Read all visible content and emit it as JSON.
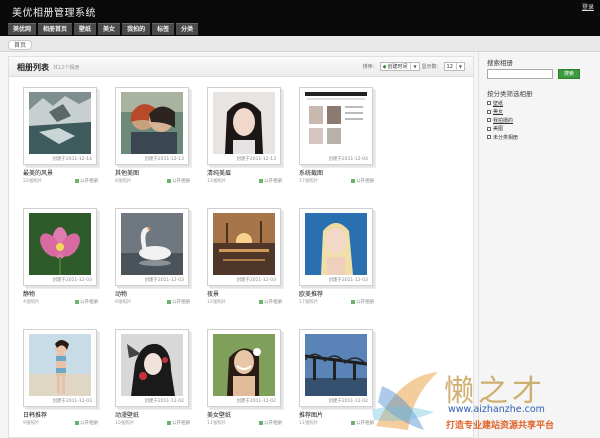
{
  "header": {
    "title": "美优相册管理系统",
    "login_label": "登录",
    "nav": [
      {
        "label": "美优网"
      },
      {
        "label": "相册首页"
      },
      {
        "label": "壁纸"
      },
      {
        "label": "美女"
      },
      {
        "label": "我拍的"
      },
      {
        "label": "标签"
      },
      {
        "label": "分类"
      }
    ]
  },
  "breadcrumb": {
    "home": "首页"
  },
  "main": {
    "title": "相册列表",
    "count_text": "共12个相册",
    "sort_label": "排序：",
    "sort_value": "创建时间",
    "show_label": "显示数：",
    "show_value": "12",
    "albums": [
      {
        "name": "最美的风景",
        "date": "创建于2011-12-14",
        "count": "22张照片",
        "status": "公开相册"
      },
      {
        "name": "其他美图",
        "date": "创建于2011-12-13",
        "count": "8张照片",
        "status": "公开相册"
      },
      {
        "name": "清纯美眉",
        "date": "创建于2011-12-13",
        "count": "13张照片",
        "status": "公开相册"
      },
      {
        "name": "系统截图",
        "date": "创建于2011-12-04",
        "count": "17张照片",
        "status": "公开相册"
      },
      {
        "name": "静物",
        "date": "创建于2011-12-03",
        "count": "4张照片",
        "status": "公开相册"
      },
      {
        "name": "动物",
        "date": "创建于2011-12-03",
        "count": "6张照片",
        "status": "公开相册"
      },
      {
        "name": "夜景",
        "date": "创建于2011-12-03",
        "count": "12张照片",
        "status": "公开相册"
      },
      {
        "name": "欧美推荐",
        "date": "创建于2011-12-03",
        "count": "17张照片",
        "status": "公开相册"
      },
      {
        "name": "日韩推荐",
        "date": "创建于2011-12-03",
        "count": "9张照片",
        "status": "公开相册"
      },
      {
        "name": "动漫壁纸",
        "date": "创建于2011-12-02",
        "count": "10张照片",
        "status": "公开相册"
      },
      {
        "name": "美女壁纸",
        "date": "创建于2011-12-02",
        "count": "11张照片",
        "status": "公开相册"
      },
      {
        "name": "推荐图片",
        "date": "创建于2011-12-02",
        "count": "11张照片",
        "status": "公开相册"
      }
    ]
  },
  "sidebar": {
    "search_title": "搜索相册",
    "search_value": "",
    "search_button": "搜索",
    "filter_title": "按分类筛选相册",
    "filters": [
      {
        "label": "壁纸"
      },
      {
        "label": "美女"
      },
      {
        "label": "我拍摄的"
      },
      {
        "label": "美图"
      },
      {
        "label": "未分类相册"
      }
    ]
  },
  "watermark": {
    "logo_text": "懒之才",
    "url": "www.aizhanzhe.com",
    "slogan": "打造专业建站资源共享平台"
  },
  "colors": {
    "header_bg": "#0a0a0a",
    "nav_bg": "#4a4a4a",
    "accent_green": "#3d9b3d",
    "watermark_blue": "#2b5fb5",
    "watermark_orange": "#e1652b"
  }
}
